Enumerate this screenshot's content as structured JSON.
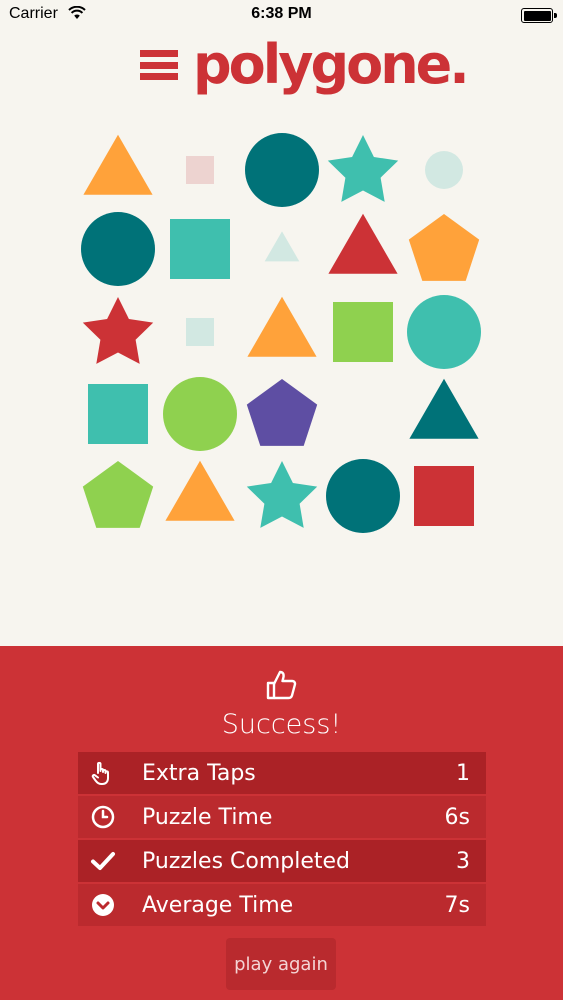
{
  "status_bar": {
    "carrier": "Carrier",
    "time": "6:38 PM"
  },
  "header": {
    "logo": "polygone."
  },
  "colors": {
    "brand_red": "#cc3236",
    "orange": "#ffa23a",
    "teal_dark": "#007278",
    "teal": "#3fbfae",
    "green": "#8fd14f",
    "purple": "#5e4ea3",
    "pale_pink": "#edd3d0",
    "pale_teal": "#d2e8e2",
    "background": "#f7f5ef"
  },
  "shapes": [
    {
      "shape": "triangle",
      "color": "orange",
      "size": "large"
    },
    {
      "shape": "square",
      "color": "pale_pink",
      "size": "small"
    },
    {
      "shape": "circle",
      "color": "teal_dark",
      "size": "large"
    },
    {
      "shape": "star",
      "color": "teal",
      "size": "large"
    },
    {
      "shape": "circle",
      "color": "pale_teal",
      "size": "small"
    },
    {
      "shape": "circle",
      "color": "teal_dark",
      "size": "large"
    },
    {
      "shape": "square",
      "color": "teal",
      "size": "large"
    },
    {
      "shape": "triangle",
      "color": "pale_teal",
      "size": "small"
    },
    {
      "shape": "triangle",
      "color": "brand_red",
      "size": "large"
    },
    {
      "shape": "pentagon",
      "color": "orange",
      "size": "large"
    },
    {
      "shape": "star",
      "color": "brand_red",
      "size": "large"
    },
    {
      "shape": "square",
      "color": "pale_teal",
      "size": "small"
    },
    {
      "shape": "triangle",
      "color": "orange",
      "size": "large"
    },
    {
      "shape": "square",
      "color": "green",
      "size": "large"
    },
    {
      "shape": "circle",
      "color": "teal",
      "size": "large"
    },
    {
      "shape": "square",
      "color": "teal",
      "size": "large"
    },
    {
      "shape": "circle",
      "color": "green",
      "size": "large"
    },
    {
      "shape": "pentagon",
      "color": "purple",
      "size": "large"
    },
    {
      "shape": "empty",
      "color": "",
      "size": ""
    },
    {
      "shape": "triangle",
      "color": "teal_dark",
      "size": "large"
    },
    {
      "shape": "pentagon",
      "color": "green",
      "size": "large"
    },
    {
      "shape": "triangle",
      "color": "orange",
      "size": "large"
    },
    {
      "shape": "star",
      "color": "teal",
      "size": "large"
    },
    {
      "shape": "circle",
      "color": "teal_dark",
      "size": "large"
    },
    {
      "shape": "square",
      "color": "brand_red",
      "size": "large"
    }
  ],
  "result": {
    "title": "Success!",
    "stats": [
      {
        "icon": "pointing-hand-icon",
        "label": "Extra Taps",
        "value": "1"
      },
      {
        "icon": "clock-icon",
        "label": "Puzzle Time",
        "value": "6s"
      },
      {
        "icon": "checkmark-icon",
        "label": "Puzzles Completed",
        "value": "3"
      },
      {
        "icon": "chevron-circle-icon",
        "label": "Average Time",
        "value": "7s"
      }
    ],
    "play_again_label": "play again"
  }
}
